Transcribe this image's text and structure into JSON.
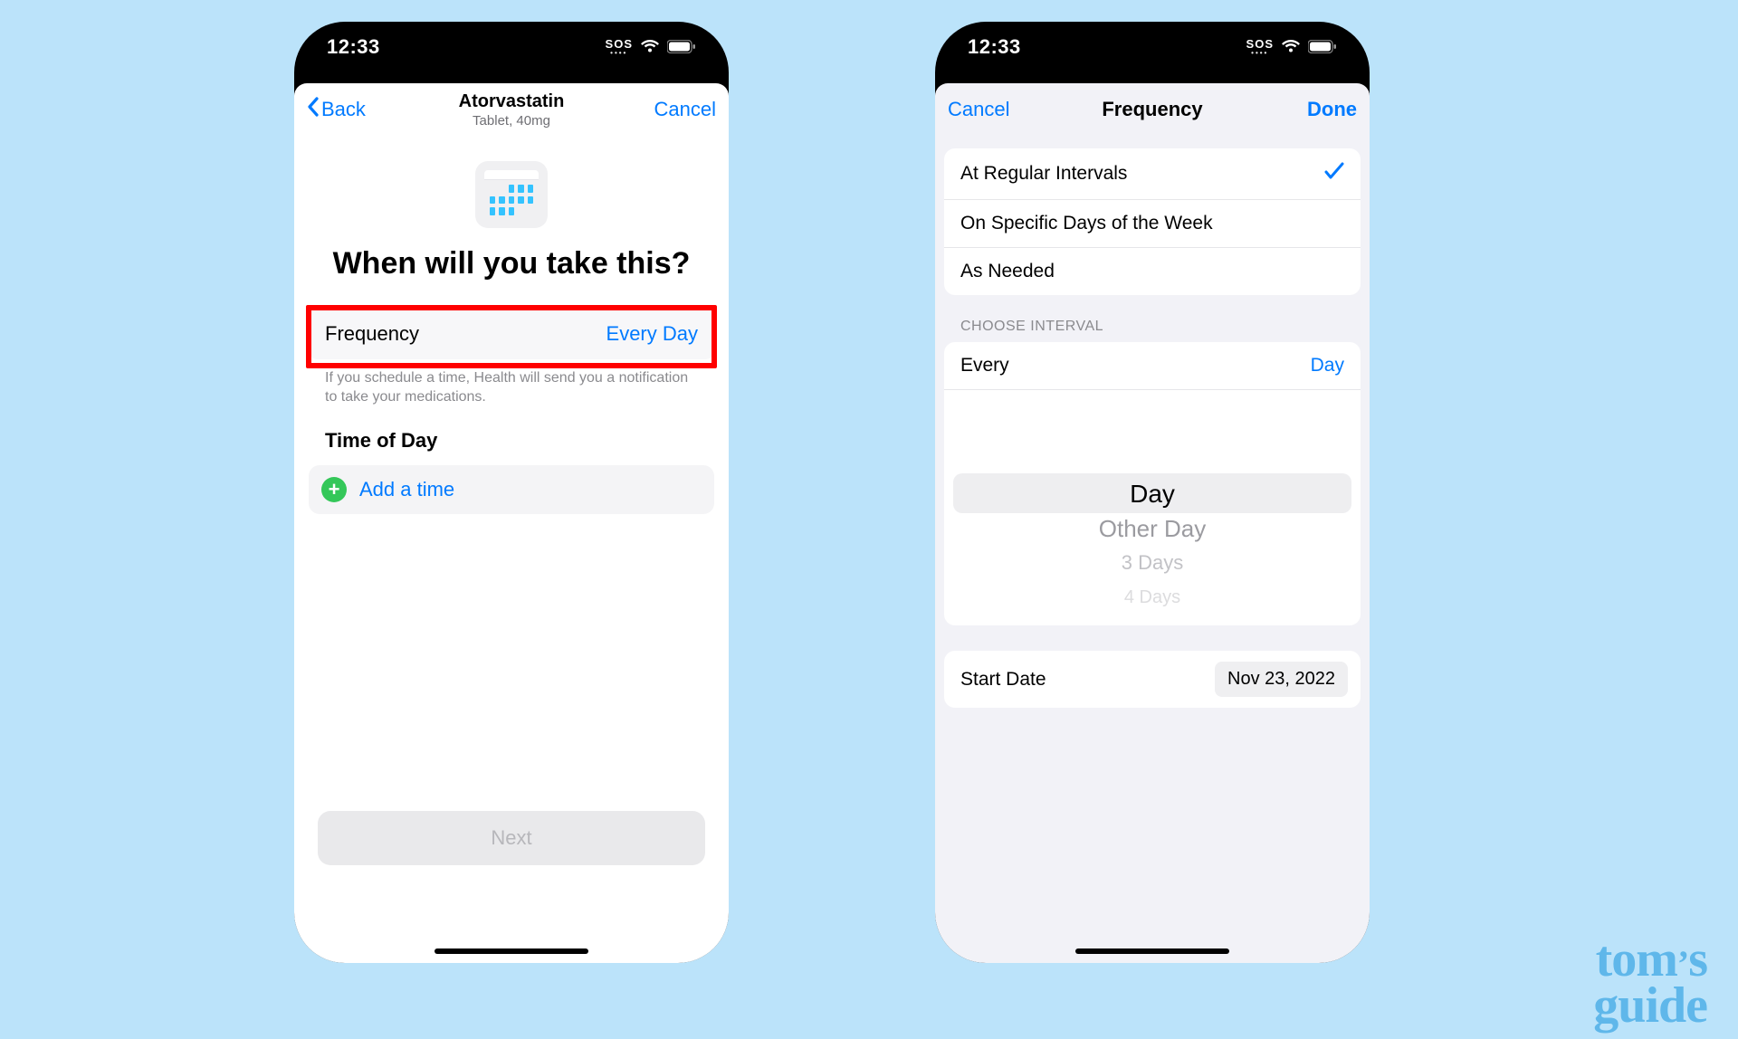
{
  "colors": {
    "accent": "#007aff",
    "highlight": "#ff0000",
    "bg": "#bbe3fa"
  },
  "status": {
    "time": "12:33",
    "sos": "SOS"
  },
  "left": {
    "nav": {
      "back": "Back",
      "title": "Atorvastatin",
      "subtitle": "Tablet, 40mg",
      "cancel": "Cancel"
    },
    "heading": "When will you take this?",
    "frequency": {
      "label": "Frequency",
      "value": "Every Day"
    },
    "hint": "If you schedule a time, Health will send you a notification to take your medications.",
    "time_section": "Time of Day",
    "add_time": "Add a time",
    "next": "Next"
  },
  "right": {
    "nav": {
      "cancel": "Cancel",
      "title": "Frequency",
      "done": "Done"
    },
    "options": [
      {
        "label": "At Regular Intervals",
        "selected": true
      },
      {
        "label": "On Specific Days of the Week",
        "selected": false
      },
      {
        "label": "As Needed",
        "selected": false
      }
    ],
    "choose_header": "CHOOSE INTERVAL",
    "interval": {
      "label": "Every",
      "value": "Day"
    },
    "picker": [
      "Day",
      "Other Day",
      "3 Days",
      "4 Days"
    ],
    "start": {
      "label": "Start Date",
      "value": "Nov 23, 2022"
    }
  },
  "watermark": {
    "line1": "tom",
    "apos": "’",
    "s": "s",
    "line2": "guide"
  }
}
